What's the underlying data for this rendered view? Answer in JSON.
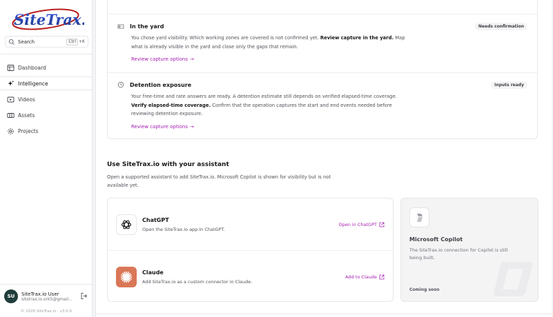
{
  "app": {
    "logo_text": "SiteTrax.io"
  },
  "search": {
    "label": "Search",
    "kbd": "Ctrl",
    "kbd_key": "+K"
  },
  "sidebar": {
    "items": [
      {
        "label": "Dashboard",
        "icon": "dashboard-icon"
      },
      {
        "label": "Intelligence",
        "icon": "sparkle-icon",
        "active": true
      },
      {
        "label": "Videos",
        "icon": "video-icon"
      },
      {
        "label": "Assets",
        "icon": "assets-icon"
      },
      {
        "label": "Projects",
        "icon": "gear-icon"
      }
    ],
    "user": {
      "initials": "SU",
      "name": "SiteTrax.io User",
      "email": "sitetrax.io.ork5@gmail..."
    },
    "copyright": "© 2026 SiteTrax.io · v3.0.0"
  },
  "capture": {
    "yard": {
      "title": "In the yard",
      "badge": "Needs confirmation",
      "desc_1": "You chose yard visibility. Which working zones are covered is not confirmed yet. ",
      "desc_bold": "Review capture in the yard.",
      "desc_2": " Map what is already visible in the yard and close only the gaps that remain.",
      "link": "Review capture options",
      "arrow": "→"
    },
    "detention": {
      "title": "Detention exposure",
      "badge": "Inputs ready",
      "desc_1": "Your free-time and rate answers are ready. A detention estimate still depends on verified elapsed-time coverage. ",
      "desc_bold": "Verify elapsed-time coverage.",
      "desc_2": " Confirm that the operation captures the start and end events needed before reviewing detention exposure.",
      "link": "Review capture options",
      "arrow": "→"
    }
  },
  "assistants_section": {
    "title": "Use SiteTrax.io with your assistant",
    "subtitle": "Open a supported assistant to add SiteTrax.io. Microsoft Copilot is shown for visibility but is not available yet.",
    "chatgpt": {
      "name": "ChatGPT",
      "desc": "Open the SiteTrax.io app in ChatGPT.",
      "action": "Open in ChatGPT"
    },
    "claude": {
      "name": "Claude",
      "desc": "Add SiteTrax.io as a custom connector in Claude.",
      "action": "Add to Claude"
    },
    "copilot": {
      "name": "Microsoft Copilot",
      "desc": "The SiteTrax.io connection for Copilot is still being built.",
      "status": "Coming soon"
    }
  },
  "colors": {
    "accent": "#a21caf",
    "claude": "#d97757",
    "logo_blue": "#1e3a8a",
    "avatar": "#1f3d3a"
  }
}
